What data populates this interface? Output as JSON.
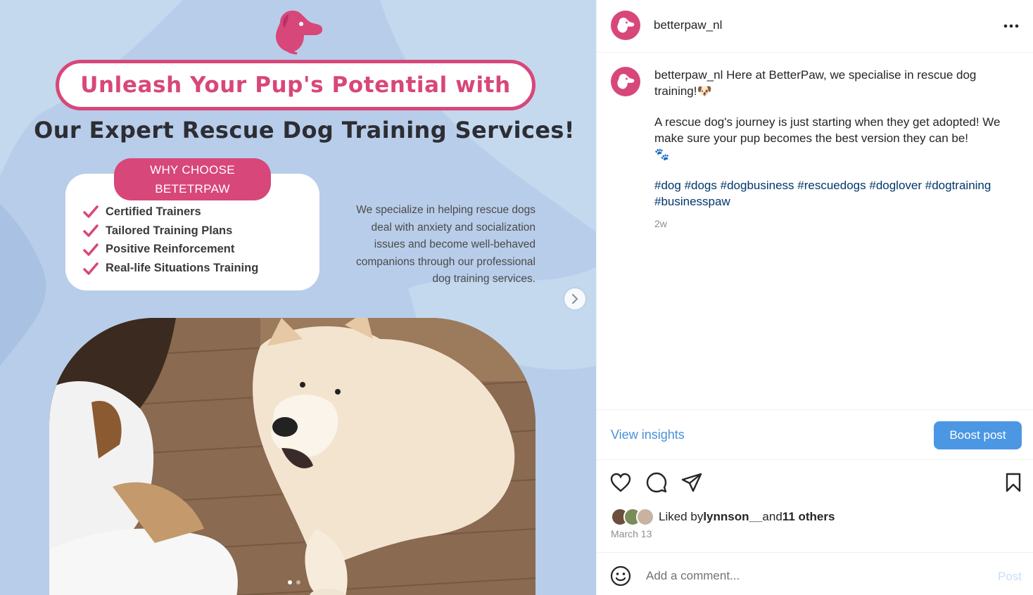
{
  "post_image": {
    "headline_line1": "Unleash Your Pup's Potential with",
    "headline_line2": "Our Expert Rescue Dog Training Services!",
    "why_title_line1": "WHY CHOOSE",
    "why_title_line2": "BETETRPAW",
    "why_items": [
      "Certified Trainers",
      "Tailored Training Plans",
      "Positive Reinforcement",
      "Real-life Situations Training"
    ],
    "description_lines": [
      "We specialize in helping rescue dogs",
      "deal with anxiety and socialization",
      "issues and become well-behaved",
      "companions through our professional",
      "dog training services."
    ],
    "brand_color": "#d8477a",
    "background_color": "#b8cde9",
    "carousel_icon": "chevron-right-icon"
  },
  "header": {
    "username": "betterpaw_nl",
    "more_icon": "more-horizontal-icon"
  },
  "caption": {
    "username": "betterpaw_nl",
    "line1": " Here at BetterPaw, we specialise in rescue dog training!",
    "line1_emoji": "🐶",
    "paragraph2": "A rescue dog's journey is just starting when they get adopted! We make sure your pup becomes the best version they can be!",
    "paragraph2_emoji": "🐾",
    "hashtags": [
      "#dog",
      "#dogs",
      "#dogbusiness",
      "#rescuedogs",
      "#doglover",
      "#dogtraining",
      "#businesspaw"
    ],
    "time_ago": "2w"
  },
  "insights": {
    "view_label": "View insights",
    "boost_label": "Boost post",
    "accent_color": "#4c97e3"
  },
  "actions": {
    "icons": [
      "heart-icon",
      "comment-icon",
      "share-icon",
      "bookmark-icon"
    ]
  },
  "likes": {
    "prefix": "Liked by ",
    "user": "lynnson__",
    "middle": " and ",
    "others": "11 others"
  },
  "date": "March 13",
  "comment": {
    "placeholder": "Add a comment...",
    "post_label": "Post",
    "emoji_icon": "smiley-icon"
  }
}
